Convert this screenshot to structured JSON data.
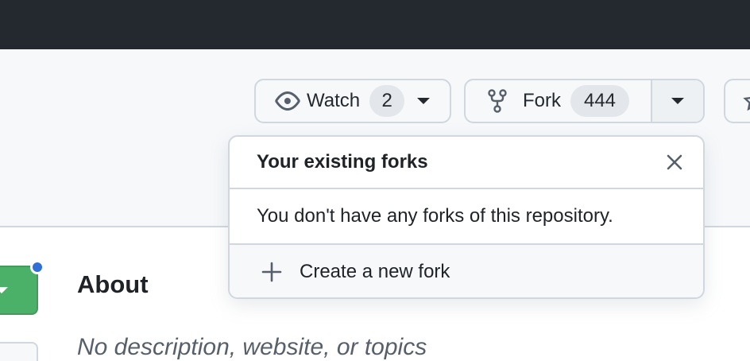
{
  "header": {
    "watch": {
      "label": "Watch",
      "count": "2"
    },
    "fork": {
      "label": "Fork",
      "count": "444"
    }
  },
  "fork_popover": {
    "title": "Your existing forks",
    "empty_message": "You don't have any forks of this repository.",
    "create_label": "Create a new fork"
  },
  "about": {
    "title": "About",
    "description": "No description, website, or topics"
  },
  "colors": {
    "topbar": "#24292f",
    "primary_button": "#2da44e",
    "notification_dot": "#2f6fd6"
  },
  "icons": [
    "eye-icon",
    "caret-down-icon",
    "repo-forked-icon",
    "star-icon",
    "close-icon",
    "plus-icon"
  ]
}
